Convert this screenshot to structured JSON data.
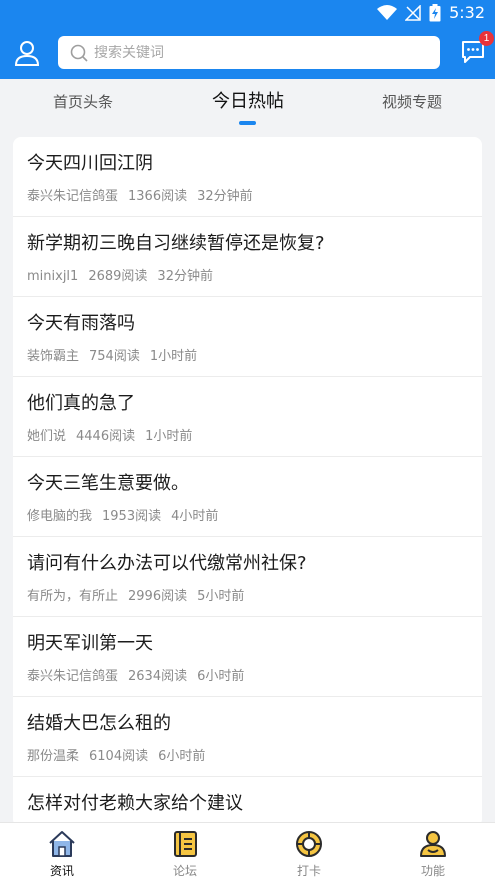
{
  "status_bar": {
    "time": "5:32"
  },
  "header": {
    "search_placeholder": "搜索关键词",
    "message_badge": "1"
  },
  "tabs": [
    {
      "label": "首页头条"
    },
    {
      "label": "今日热帖"
    },
    {
      "label": "视频专题"
    }
  ],
  "posts": [
    {
      "title": "今天四川回江阴",
      "author": "泰兴朱记信鸽蛋",
      "reads": "1366阅读",
      "time": "32分钟前"
    },
    {
      "title": "新学期初三晚自习继续暂停还是恢复?",
      "author": "minixjl1",
      "reads": "2689阅读",
      "time": "32分钟前"
    },
    {
      "title": "今天有雨落吗",
      "author": "装饰霸主",
      "reads": "754阅读",
      "time": "1小时前"
    },
    {
      "title": "他们真的急了",
      "author": "她们说",
      "reads": "4446阅读",
      "time": "1小时前"
    },
    {
      "title": "今天三笔生意要做。",
      "author": "修电脑的我",
      "reads": "1953阅读",
      "time": "4小时前"
    },
    {
      "title": "请问有什么办法可以代缴常州社保?",
      "author": "有所为，有所止",
      "reads": "2996阅读",
      "time": "5小时前"
    },
    {
      "title": "明天军训第一天",
      "author": "泰兴朱记信鸽蛋",
      "reads": "2634阅读",
      "time": "6小时前"
    },
    {
      "title": "结婚大巴怎么租的",
      "author": "那份温柔",
      "reads": "6104阅读",
      "time": "6小时前"
    },
    {
      "title": "怎样对付老赖大家给个建议",
      "author": "",
      "reads": "",
      "time": ""
    }
  ],
  "bottom_nav": [
    {
      "label": "资讯",
      "icon": "house-icon"
    },
    {
      "label": "论坛",
      "icon": "book-icon"
    },
    {
      "label": "打卡",
      "icon": "checkin-icon"
    },
    {
      "label": "功能",
      "icon": "person-icon"
    }
  ],
  "colors": {
    "primary": "#1b86ef",
    "badge": "#e9333a",
    "nav_accent": "#f5c542"
  }
}
